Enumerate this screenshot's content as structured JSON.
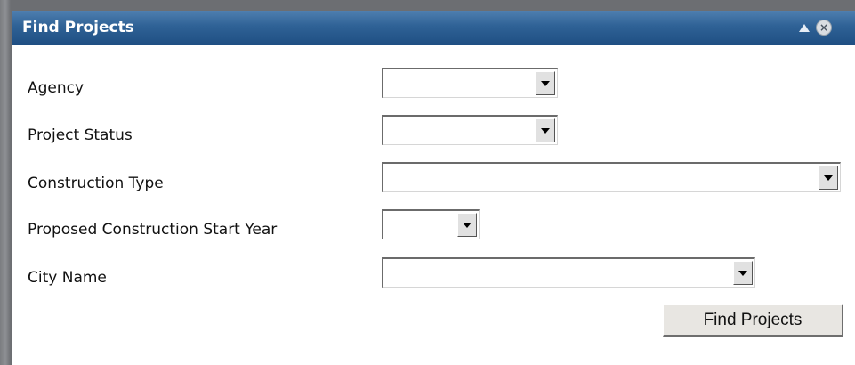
{
  "panel": {
    "title": "Find Projects"
  },
  "form": {
    "fields": [
      {
        "label": "Agency",
        "value": ""
      },
      {
        "label": "Project Status",
        "value": ""
      },
      {
        "label": "Construction Type",
        "value": ""
      },
      {
        "label": "Proposed Construction Start Year",
        "value": ""
      },
      {
        "label": "City Name",
        "value": ""
      }
    ],
    "submit_label": "Find Projects"
  },
  "icons": {
    "collapse": "triangle-up-icon",
    "close": "close-circle-icon",
    "dropdown": "chevron-down-icon"
  },
  "colors": {
    "titlebar": "#2f6296",
    "panel_bg": "#ffffff"
  }
}
